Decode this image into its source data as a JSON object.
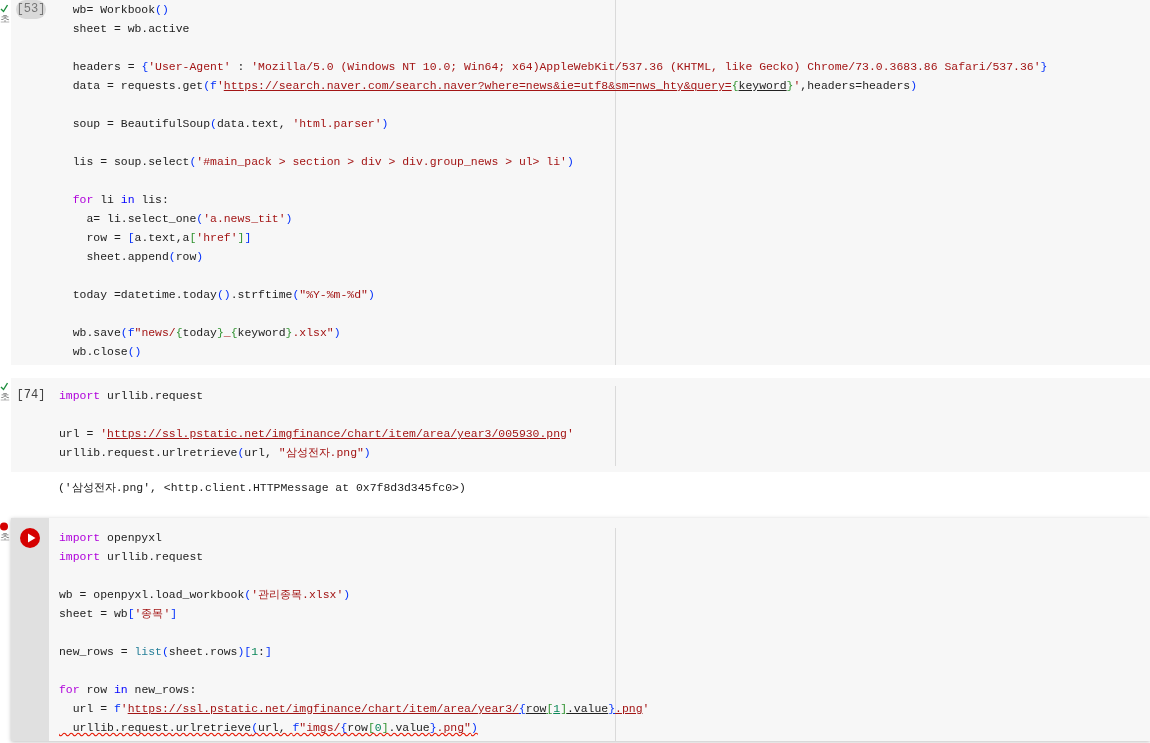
{
  "cells": [
    {
      "error": false,
      "status_label": "초",
      "execution_count": "[53]",
      "hovered": true,
      "focused": false,
      "lines": [
        {
          "kind": "code",
          "tokens": [
            {
              "kind": "plain",
              "text": "  wb= Workbook"
            },
            {
              "kind": "bracket",
              "text": "("
            },
            {
              "kind": "bracket",
              "text": ")"
            }
          ]
        },
        {
          "kind": "code",
          "tokens": [
            {
              "kind": "plain",
              "text": "  sheet = wb.active"
            }
          ]
        },
        {
          "kind": "blank"
        },
        {
          "kind": "code",
          "tokens": [
            {
              "kind": "plain",
              "text": "  headers = "
            },
            {
              "kind": "bracket",
              "text": "{"
            },
            {
              "kind": "string",
              "text": "'User-Agent'"
            },
            {
              "kind": "plain",
              "text": " : "
            },
            {
              "kind": "string",
              "text": "'Mozilla/5.0 (Windows NT 10.0; Win64; x64)AppleWebKit/537.36 (KHTML, like Gecko) Chrome/73.0.3683.86 Safari/537.36'"
            },
            {
              "kind": "bracket",
              "text": "}"
            }
          ]
        },
        {
          "kind": "code",
          "tokens": [
            {
              "kind": "plain",
              "text": "  data = requests.get"
            },
            {
              "kind": "bracket",
              "text": "("
            },
            {
              "kind": "bracket",
              "text": "f"
            },
            {
              "kind": "string",
              "text": "'"
            },
            {
              "kind": "string",
              "text": "https://search.naver.com/search.naver?where=news&ie=utf8&sm=nws_hty&query=",
              "linked": true
            },
            {
              "kind": "bracket2",
              "text": "{"
            },
            {
              "kind": "plain",
              "text": "keyword",
              "linked": true
            },
            {
              "kind": "bracket2",
              "text": "}"
            },
            {
              "kind": "string",
              "text": "'"
            },
            {
              "kind": "plain",
              "text": ",headers=headers"
            },
            {
              "kind": "bracket",
              "text": ")"
            }
          ]
        },
        {
          "kind": "blank"
        },
        {
          "kind": "code",
          "tokens": [
            {
              "kind": "plain",
              "text": "  soup = BeautifulSoup"
            },
            {
              "kind": "bracket",
              "text": "("
            },
            {
              "kind": "plain",
              "text": "data.text, "
            },
            {
              "kind": "string",
              "text": "'html.parser'"
            },
            {
              "kind": "bracket",
              "text": ")"
            }
          ]
        },
        {
          "kind": "blank"
        },
        {
          "kind": "code",
          "tokens": [
            {
              "kind": "plain",
              "text": "  lis = soup.select"
            },
            {
              "kind": "bracket",
              "text": "("
            },
            {
              "kind": "string",
              "text": "'#main_pack > section > div > div.group_news > ul> li'"
            },
            {
              "kind": "bracket",
              "text": ")"
            }
          ]
        },
        {
          "kind": "blank"
        },
        {
          "kind": "code",
          "tokens": [
            {
              "kind": "keyword",
              "text": "  for"
            },
            {
              "kind": "plain",
              "text": " li "
            },
            {
              "kind": "control",
              "text": "in"
            },
            {
              "kind": "plain",
              "text": " lis:"
            }
          ]
        },
        {
          "kind": "code",
          "tokens": [
            {
              "kind": "plain",
              "text": "    a= li.select_one"
            },
            {
              "kind": "bracket",
              "text": "("
            },
            {
              "kind": "string",
              "text": "'a.news_tit'"
            },
            {
              "kind": "bracket",
              "text": ")"
            }
          ]
        },
        {
          "kind": "code",
          "tokens": [
            {
              "kind": "plain",
              "text": "    row = "
            },
            {
              "kind": "bracket",
              "text": "["
            },
            {
              "kind": "plain",
              "text": "a.text,a"
            },
            {
              "kind": "bracket2",
              "text": "["
            },
            {
              "kind": "string",
              "text": "'href'"
            },
            {
              "kind": "bracket2",
              "text": "]"
            },
            {
              "kind": "bracket",
              "text": "]"
            }
          ]
        },
        {
          "kind": "code",
          "tokens": [
            {
              "kind": "plain",
              "text": "    sheet.append"
            },
            {
              "kind": "bracket",
              "text": "("
            },
            {
              "kind": "plain",
              "text": "row"
            },
            {
              "kind": "bracket",
              "text": ")"
            }
          ]
        },
        {
          "kind": "blank"
        },
        {
          "kind": "code",
          "tokens": [
            {
              "kind": "plain",
              "text": "  today =datetime.today"
            },
            {
              "kind": "bracket",
              "text": "("
            },
            {
              "kind": "bracket",
              "text": ")"
            },
            {
              "kind": "plain",
              "text": ".strftime"
            },
            {
              "kind": "bracket",
              "text": "("
            },
            {
              "kind": "string",
              "text": "\"%Y-%m-%d\""
            },
            {
              "kind": "bracket",
              "text": ")"
            }
          ]
        },
        {
          "kind": "blank"
        },
        {
          "kind": "code",
          "tokens": [
            {
              "kind": "plain",
              "text": "  wb.save"
            },
            {
              "kind": "bracket",
              "text": "("
            },
            {
              "kind": "bracket",
              "text": "f"
            },
            {
              "kind": "string",
              "text": "\"news/"
            },
            {
              "kind": "bracket2",
              "text": "{"
            },
            {
              "kind": "plain",
              "text": "today"
            },
            {
              "kind": "bracket2",
              "text": "}"
            },
            {
              "kind": "string",
              "text": "_"
            },
            {
              "kind": "bracket2",
              "text": "{"
            },
            {
              "kind": "plain",
              "text": "keyword"
            },
            {
              "kind": "bracket2",
              "text": "}"
            },
            {
              "kind": "string",
              "text": ".xlsx\""
            },
            {
              "kind": "bracket",
              "text": ")"
            }
          ]
        },
        {
          "kind": "code",
          "tokens": [
            {
              "kind": "plain",
              "text": "  wb.close"
            },
            {
              "kind": "bracket",
              "text": "("
            },
            {
              "kind": "bracket",
              "text": ")"
            }
          ]
        }
      ]
    },
    {
      "error": false,
      "status_label": "초",
      "execution_count": "[74]",
      "hovered": false,
      "focused": false,
      "lines": [
        {
          "kind": "code",
          "tokens": [
            {
              "kind": "keyword",
              "text": "import"
            },
            {
              "kind": "plain",
              "text": " urllib.request"
            }
          ]
        },
        {
          "kind": "blank"
        },
        {
          "kind": "code",
          "tokens": [
            {
              "kind": "plain",
              "text": "url = "
            },
            {
              "kind": "string",
              "text": "'"
            },
            {
              "kind": "string",
              "text": "https://ssl.pstatic.net/imgfinance/chart/item/area/year3/005930.png",
              "linked": true
            },
            {
              "kind": "string",
              "text": "'"
            }
          ]
        },
        {
          "kind": "code",
          "tokens": [
            {
              "kind": "plain",
              "text": "urllib.request.urlretrieve"
            },
            {
              "kind": "bracket",
              "text": "("
            },
            {
              "kind": "plain",
              "text": "url, "
            },
            {
              "kind": "string",
              "text": "\"삼성전자.png\""
            },
            {
              "kind": "bracket",
              "text": ")"
            }
          ]
        }
      ],
      "output": "('삼성전자.png', <http.client.HTTPMessage at 0x7f8d3d345fc0>)"
    },
    {
      "error": true,
      "status_label": "초",
      "focused": true,
      "lines": [
        {
          "kind": "code",
          "tokens": [
            {
              "kind": "keyword",
              "text": "import"
            },
            {
              "kind": "plain",
              "text": " openpyxl"
            }
          ]
        },
        {
          "kind": "code",
          "tokens": [
            {
              "kind": "keyword",
              "text": "import"
            },
            {
              "kind": "plain",
              "text": " urllib.request"
            }
          ]
        },
        {
          "kind": "blank"
        },
        {
          "kind": "code",
          "tokens": [
            {
              "kind": "plain",
              "text": "wb = openpyxl.load_workbook"
            },
            {
              "kind": "bracket",
              "text": "("
            },
            {
              "kind": "string",
              "text": "'관리종목.xlsx'"
            },
            {
              "kind": "bracket",
              "text": ")"
            }
          ]
        },
        {
          "kind": "code",
          "tokens": [
            {
              "kind": "plain",
              "text": "sheet = wb"
            },
            {
              "kind": "bracket",
              "text": "["
            },
            {
              "kind": "string",
              "text": "'종목'"
            },
            {
              "kind": "bracket",
              "text": "]"
            }
          ]
        },
        {
          "kind": "blank"
        },
        {
          "kind": "code",
          "tokens": [
            {
              "kind": "plain",
              "text": "new_rows = "
            },
            {
              "kind": "builtin",
              "text": "list"
            },
            {
              "kind": "bracket",
              "text": "("
            },
            {
              "kind": "plain",
              "text": "sheet.rows"
            },
            {
              "kind": "bracket",
              "text": ")"
            },
            {
              "kind": "bracket",
              "text": "["
            },
            {
              "kind": "number",
              "text": "1"
            },
            {
              "kind": "plain",
              "text": ":"
            },
            {
              "kind": "bracket",
              "text": "]"
            }
          ]
        },
        {
          "kind": "blank"
        },
        {
          "kind": "code",
          "tokens": [
            {
              "kind": "keyword",
              "text": "for"
            },
            {
              "kind": "plain",
              "text": " row "
            },
            {
              "kind": "control",
              "text": "in"
            },
            {
              "kind": "plain",
              "text": " new_rows:"
            }
          ]
        },
        {
          "kind": "code",
          "tokens": [
            {
              "kind": "plain",
              "text": "  url = "
            },
            {
              "kind": "bracket",
              "text": "f"
            },
            {
              "kind": "string",
              "text": "'"
            },
            {
              "kind": "string",
              "text": "https://ssl.pstatic.net/imgfinance/chart/item/area/year3/",
              "linked": true
            },
            {
              "kind": "bracket",
              "text": "{",
              "linked": true
            },
            {
              "kind": "plain",
              "text": "row",
              "linked": true
            },
            {
              "kind": "bracket2",
              "text": "[",
              "linked": true
            },
            {
              "kind": "number",
              "text": "1",
              "linked": true
            },
            {
              "kind": "bracket2",
              "text": "]",
              "linked": true
            },
            {
              "kind": "plain",
              "text": ".value",
              "linked": true
            },
            {
              "kind": "bracket",
              "text": "}",
              "linked": true
            },
            {
              "kind": "string",
              "text": ".png",
              "linked": true
            },
            {
              "kind": "string",
              "text": "'"
            }
          ]
        },
        {
          "kind": "error-code",
          "tokens": [
            {
              "kind": "plain",
              "text": "  urllib.request.urlretrieve"
            },
            {
              "kind": "bracket",
              "text": "("
            },
            {
              "kind": "plain",
              "text": "url, "
            },
            {
              "kind": "bracket",
              "text": "f"
            },
            {
              "kind": "string",
              "text": "\"imgs/"
            },
            {
              "kind": "bracket",
              "text": "{"
            },
            {
              "kind": "plain",
              "text": "row"
            },
            {
              "kind": "bracket2",
              "text": "["
            },
            {
              "kind": "number",
              "text": "0"
            },
            {
              "kind": "bracket2",
              "text": "]"
            },
            {
              "kind": "plain",
              "text": ".value"
            },
            {
              "kind": "bracket",
              "text": "}"
            },
            {
              "kind": "string",
              "text": ".png\""
            },
            {
              "kind": "bracket",
              "text": ")"
            }
          ]
        }
      ]
    }
  ]
}
